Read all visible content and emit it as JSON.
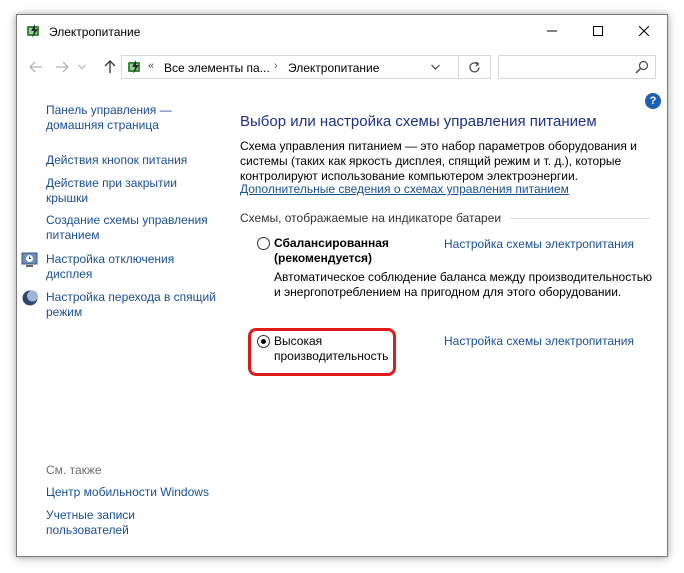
{
  "window": {
    "title": "Электропитание"
  },
  "address": {
    "chevrons": "«",
    "crumbs": [
      "Все элементы па...",
      "Электропитание"
    ],
    "separator": "›"
  },
  "search": {
    "placeholder": ""
  },
  "help": {
    "label": "?"
  },
  "left_pane": {
    "home": "Панель управления — домашняя страница",
    "items": [
      "Действия кнопок питания",
      "Действие при закрытии крышки",
      "Создание схемы управления питанием",
      "Настройка отключения дисплея",
      "Настройка перехода в спящий режим"
    ],
    "see_also": "См. также",
    "see_also_items": [
      "Центр мобильности Windows",
      "Учетные записи пользователей"
    ]
  },
  "main": {
    "title": "Выбор или настройка схемы управления питанием",
    "description": "Схема управления питанием — это набор параметров оборудования и системы (таких как яркость дисплея, спящий режим и т. д.), которые контролируют использование компьютером электроэнергии.",
    "more_link": "Дополнительные сведения о схемах управления питанием",
    "group_title": "Схемы, отображаемые на индикаторе батареи",
    "plans": [
      {
        "name": "Сбалансированная (рекомендуется)",
        "description": "Автоматическое соблюдение баланса между производительностью и энергопотреблением на пригодном для этого оборудовании.",
        "link": "Настройка схемы электропитания",
        "selected": false
      },
      {
        "name": "Высокая производительность",
        "description": "",
        "link": "Настройка схемы электропитания",
        "selected": true
      }
    ]
  },
  "colors": {
    "link": "#1a4f91",
    "title": "#1e3287",
    "highlight": "#e01b1b",
    "help": "#1c5fb5"
  }
}
